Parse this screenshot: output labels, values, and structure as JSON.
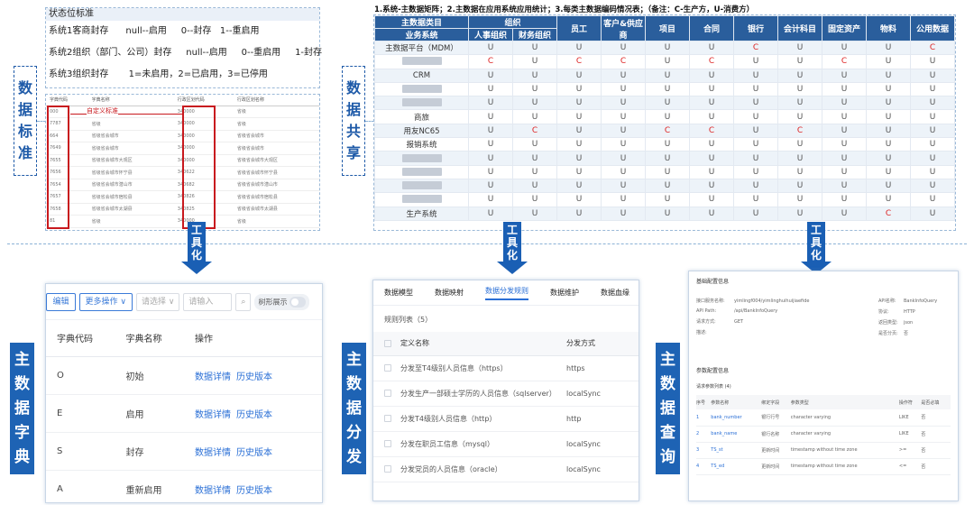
{
  "status": {
    "title": "状态位标准",
    "rows": [
      "系统1客商封存      null--启用     0--封存   1--重启用",
      "系统2组织（部门、公司）封存     null--启用     0--重启用     1-封存",
      "系统3组织封存       1=未启用，2=已启用，3=已停用"
    ]
  },
  "std_table": {
    "headers": [
      "字典代码",
      "字典名称",
      "行政区划代码",
      "行政区划名称"
    ],
    "rows": [
      [
        "000",
        "省级",
        "340000",
        "省级"
      ],
      [
        "7787",
        "省级",
        "340000",
        "省级"
      ],
      [
        "664",
        "省级省会城市",
        "340000",
        "省级省会城市"
      ],
      [
        "7649",
        "省级省会城市",
        "340000",
        "省级省会城市"
      ],
      [
        "7655",
        "省级省会城市大观区",
        "340000",
        "省级省会城市大观区"
      ],
      [
        "7656",
        "省级省会城市怀宁县",
        "340622",
        "省级省会城市怀宁县"
      ],
      [
        "7654",
        "省级省会城市潜山市",
        "340682",
        "省级省会城市潜山市"
      ],
      [
        "7657",
        "省级省会城市宿松县",
        "340826",
        "省级省会城市宿松县"
      ],
      [
        "7658",
        "省级省会城市太湖县",
        "340825",
        "省级省会城市太湖县"
      ],
      [
        "81",
        "省级",
        "340000",
        "省级"
      ]
    ],
    "annotation": "自定义标准"
  },
  "labels": {
    "standard": [
      "数",
      "据",
      "标",
      "准"
    ],
    "share": [
      "数",
      "据",
      "共",
      "享"
    ],
    "dict": [
      "主",
      "数",
      "据",
      "字",
      "典"
    ],
    "dist": [
      "主",
      "数",
      "据",
      "分",
      "发"
    ],
    "query": [
      "主",
      "数",
      "据",
      "查",
      "询"
    ],
    "tool": [
      "工",
      "具",
      "化"
    ]
  },
  "share": {
    "title": "1.系统-主数据矩阵；2.主数据在应用系统应用统计；3.每类主数据编码情况表；（备注：C-生产方，U-消费方）",
    "header_top": [
      "主数据类目",
      "组织",
      "员工",
      "客户&供应商",
      "项目",
      "合同",
      "银行",
      "会计科目",
      "固定资产",
      "物料",
      "公用数据"
    ],
    "header_sub": [
      "业务系统",
      "人事组织",
      "财务组织"
    ],
    "rows": [
      {
        "name": "主数据平台（MDM）",
        "cells": [
          "U",
          "U",
          "U",
          "U",
          "U",
          "U",
          "C",
          "U",
          "U",
          "U",
          "C"
        ]
      },
      {
        "name": "",
        "cells": [
          "C",
          "U",
          "C",
          "C",
          "U",
          "C",
          "U",
          "U",
          "C",
          "U",
          "U"
        ]
      },
      {
        "name": "CRM",
        "cells": [
          "U",
          "U",
          "U",
          "U",
          "U",
          "U",
          "U",
          "U",
          "U",
          "U",
          "U"
        ]
      },
      {
        "name": "",
        "cells": [
          "U",
          "U",
          "U",
          "U",
          "U",
          "U",
          "U",
          "U",
          "U",
          "U",
          "U"
        ]
      },
      {
        "name": "",
        "cells": [
          "U",
          "U",
          "U",
          "U",
          "U",
          "U",
          "U",
          "U",
          "U",
          "U",
          "U"
        ]
      },
      {
        "name": "商旅",
        "cells": [
          "U",
          "U",
          "U",
          "U",
          "U",
          "U",
          "U",
          "U",
          "U",
          "U",
          "U"
        ]
      },
      {
        "name": "用友NC65",
        "cells": [
          "U",
          "C",
          "U",
          "U",
          "C",
          "C",
          "U",
          "C",
          "U",
          "U",
          "U"
        ]
      },
      {
        "name": "报销系统",
        "cells": [
          "U",
          "U",
          "U",
          "U",
          "U",
          "U",
          "U",
          "U",
          "U",
          "U",
          "U"
        ]
      },
      {
        "name": "",
        "cells": [
          "U",
          "U",
          "U",
          "U",
          "U",
          "U",
          "U",
          "U",
          "U",
          "U",
          "U"
        ]
      },
      {
        "name": "",
        "cells": [
          "U",
          "U",
          "U",
          "U",
          "U",
          "U",
          "U",
          "U",
          "U",
          "U",
          "U"
        ]
      },
      {
        "name": "",
        "cells": [
          "U",
          "U",
          "U",
          "U",
          "U",
          "U",
          "U",
          "U",
          "U",
          "U",
          "U"
        ]
      },
      {
        "name": "",
        "cells": [
          "U",
          "U",
          "U",
          "U",
          "U",
          "U",
          "U",
          "U",
          "U",
          "U",
          "U"
        ]
      },
      {
        "name": "生产系统",
        "cells": [
          "U",
          "U",
          "U",
          "U",
          "U",
          "U",
          "U",
          "U",
          "U",
          "C",
          "U"
        ]
      }
    ]
  },
  "dict": {
    "toolbar": {
      "edit": "编辑",
      "more": "更多操作 ∨",
      "select": "请选择  ∨",
      "input": "请输入",
      "search_icon": "⌕",
      "toggle_label": "树形展示"
    },
    "headers": [
      "字典代码",
      "字典名称",
      "操作"
    ],
    "rows": [
      {
        "code": "O",
        "name": "初始",
        "a1": "数据详情",
        "a2": "历史版本"
      },
      {
        "code": "E",
        "name": "启用",
        "a1": "数据详情",
        "a2": "历史版本"
      },
      {
        "code": "S",
        "name": "封存",
        "a1": "数据详情",
        "a2": "历史版本"
      },
      {
        "code": "A",
        "name": "重新启用",
        "a1": "数据详情",
        "a2": "历史版本"
      }
    ]
  },
  "dist": {
    "tabs": [
      "数据模型",
      "数据映射",
      "数据分发规则",
      "数据维护",
      "数据血缘"
    ],
    "count_label": "规则列表（5）",
    "headers": [
      "定义名称",
      "分发方式"
    ],
    "rows": [
      {
        "name": "分发至T4级别人员信息（https）",
        "mode": "https"
      },
      {
        "name": "分发生产一部硕士学历的人员信息（sqlserver）",
        "mode": "localSync"
      },
      {
        "name": "分发T4级别人员信息（http）",
        "mode": "http"
      },
      {
        "name": "分发在职员工信息（mysql）",
        "mode": "localSync"
      },
      {
        "name": "分发党员的人员信息（oracle）",
        "mode": "localSync"
      }
    ]
  },
  "query": {
    "section1": "基础配置信息",
    "fields_left": [
      [
        "接口服务名称:",
        "yimlingf004/yimlinghuihuijiaefide"
      ],
      [
        "API Path:",
        "/api/BankInfoQuery"
      ],
      [
        "请求方式:",
        "GET"
      ],
      [
        "描述:",
        ""
      ]
    ],
    "fields_right": [
      [
        "API名称:",
        "BankInfoQuery"
      ],
      [
        "协议:",
        "HTTP"
      ],
      [
        "返回类型:",
        "json"
      ],
      [
        "是否分页:",
        "否"
      ]
    ],
    "section2": "参数配置信息",
    "sub": "请求参数列表 (4)",
    "headers": [
      "序号",
      "参数名称",
      "绑定字段",
      "参数类型",
      "操作符",
      "是否必填"
    ],
    "rows": [
      [
        "1",
        "bank_number",
        "银行行号",
        "character varying",
        "LIKE",
        "否"
      ],
      [
        "2",
        "bank_name",
        "银行名称",
        "character varying",
        "LIKE",
        "否"
      ],
      [
        "3",
        "TS_st",
        "更新时间",
        "timestamp without time zone",
        ">=",
        "否"
      ],
      [
        "4",
        "TS_ed",
        "更新时间",
        "timestamp without time zone",
        "<=",
        "否"
      ]
    ]
  }
}
